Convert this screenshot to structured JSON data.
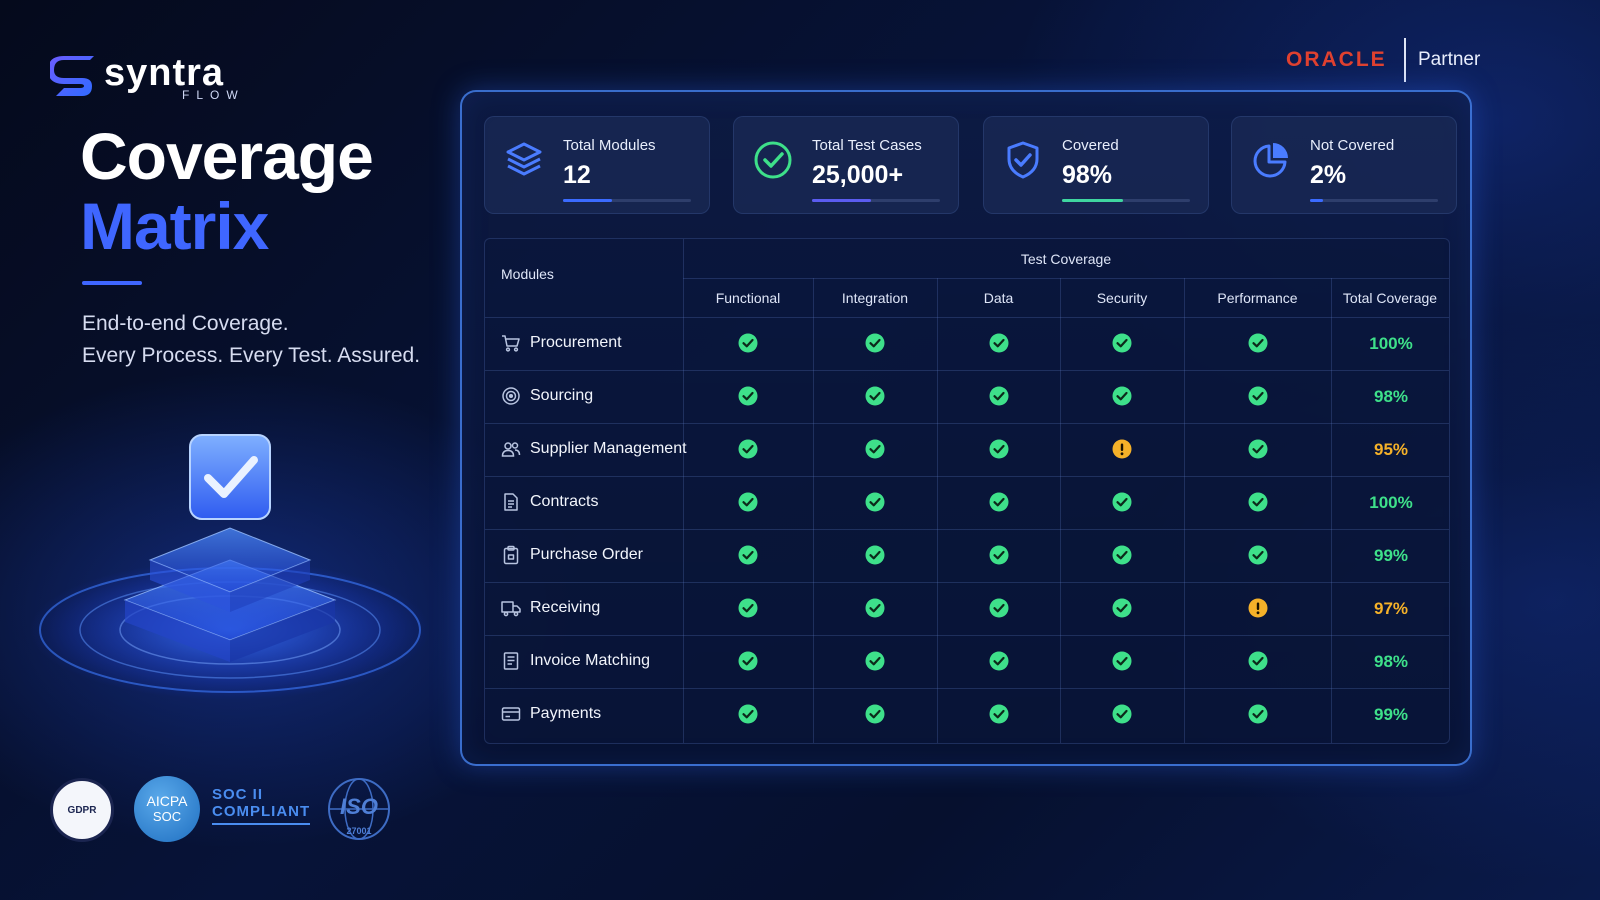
{
  "brand": {
    "name": "syntra",
    "sub": "FLOW"
  },
  "hero": {
    "title_line1": "Coverage",
    "title_line2": "Matrix",
    "tagline_line1": "End-to-end Coverage.",
    "tagline_line2": "Every Process. Every Test. Assured."
  },
  "partner": {
    "oracle": "ORACLE",
    "label": "Partner"
  },
  "stats": [
    {
      "label": "Total Modules",
      "value": "12",
      "progress": 0.38,
      "icon": "layers-icon",
      "color": "#3b6bff"
    },
    {
      "label": "Total Test Cases",
      "value": "25,000+",
      "progress": 0.46,
      "icon": "check-circle-icon",
      "color": "#5b5cf0"
    },
    {
      "label": "Covered",
      "value": "98%",
      "progress": 0.48,
      "icon": "shield-check-icon",
      "color": "#3fd6a0"
    },
    {
      "label": "Not Covered",
      "value": "2%",
      "progress": 0.1,
      "icon": "pie-chart-icon",
      "color": "#3b6bff"
    }
  ],
  "table": {
    "modules_header": "Modules",
    "group_header": "Test Coverage",
    "columns": [
      "Functional",
      "Integration",
      "Data",
      "Security",
      "Performance",
      "Total Coverage"
    ],
    "rows": [
      {
        "module": "Procurement",
        "icon": "cart-icon",
        "status": [
          "pass",
          "pass",
          "pass",
          "pass",
          "pass"
        ],
        "total": "100%",
        "total_color": "#3ee08a"
      },
      {
        "module": "Sourcing",
        "icon": "target-icon",
        "status": [
          "pass",
          "pass",
          "pass",
          "pass",
          "pass"
        ],
        "total": "98%",
        "total_color": "#3ee08a"
      },
      {
        "module": "Supplier Management",
        "icon": "users-icon",
        "status": [
          "pass",
          "pass",
          "pass",
          "warn",
          "pass"
        ],
        "total": "95%",
        "total_color": "#f5b129"
      },
      {
        "module": "Contracts",
        "icon": "document-icon",
        "status": [
          "pass",
          "pass",
          "pass",
          "pass",
          "pass"
        ],
        "total": "100%",
        "total_color": "#3ee08a"
      },
      {
        "module": "Purchase Order",
        "icon": "clipboard-icon",
        "status": [
          "pass",
          "pass",
          "pass",
          "pass",
          "pass"
        ],
        "total": "99%",
        "total_color": "#3ee08a"
      },
      {
        "module": "Receiving",
        "icon": "truck-icon",
        "status": [
          "pass",
          "pass",
          "pass",
          "pass",
          "warn"
        ],
        "total": "97%",
        "total_color": "#f5b129"
      },
      {
        "module": "Invoice Matching",
        "icon": "invoice-icon",
        "status": [
          "pass",
          "pass",
          "pass",
          "pass",
          "pass"
        ],
        "total": "98%",
        "total_color": "#3ee08a"
      },
      {
        "module": "Payments",
        "icon": "card-icon",
        "status": [
          "pass",
          "pass",
          "pass",
          "pass",
          "pass"
        ],
        "total": "99%",
        "total_color": "#3ee08a"
      }
    ]
  },
  "badges": {
    "gdpr": "GDPR",
    "aicpa_line1": "AICPA",
    "aicpa_line2": "SOC",
    "soc_line1": "SOC II",
    "soc_line2": "COMPLIANT",
    "iso": "ISO",
    "iso_num": "27001"
  },
  "colors": {
    "pass": "#3ee08a",
    "warn": "#f5b129",
    "accent": "#3f66ff"
  }
}
